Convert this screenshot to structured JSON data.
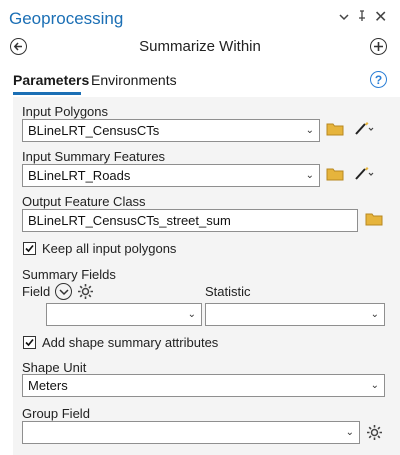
{
  "pane": {
    "title": "Geoprocessing",
    "dropdown_glyph": "⌄",
    "pin_glyph": "ꟷ",
    "close_glyph": "✕"
  },
  "tool": {
    "name": "Summarize Within",
    "back_icon": "back-arrow-icon",
    "add_icon": "plus-icon"
  },
  "tabs": [
    {
      "label": "Parameters",
      "active": true
    },
    {
      "label": "Environments",
      "active": false
    }
  ],
  "help_glyph": "?",
  "params": {
    "input_polygons": {
      "label": "Input Polygons",
      "value": "BLineLRT_CensusCTs"
    },
    "input_summary": {
      "label": "Input Summary Features",
      "value": "BLineLRT_Roads"
    },
    "output_fc": {
      "label": "Output Feature Class",
      "value": "BLineLRT_CensusCTs_street_sum"
    },
    "keep_all": {
      "label": "Keep all input polygons",
      "checked": true
    },
    "summary_fields": {
      "label": "Summary Fields",
      "field_col": "Field",
      "statistic_col": "Statistic",
      "field_value": "",
      "statistic_value": ""
    },
    "add_shape": {
      "label": "Add shape summary  attributes",
      "checked": true
    },
    "shape_unit": {
      "label": "Shape Unit",
      "value": "Meters"
    },
    "group_field": {
      "label": "Group Field",
      "value": ""
    }
  },
  "colors": {
    "accent": "#1b6fb5",
    "folder": "#e6b43c",
    "panel_bg": "#f4f4f4"
  }
}
